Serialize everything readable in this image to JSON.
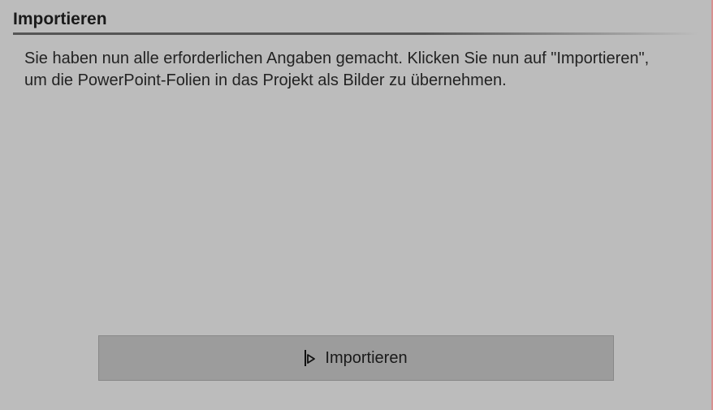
{
  "page": {
    "title": "Importieren",
    "description": "Sie haben nun alle erforderlichen Angaben gemacht. Klicken Sie nun auf \"Importieren\", um die PowerPoint-Folien in das Projekt als Bilder zu übernehmen."
  },
  "actions": {
    "import_button_label": "Importieren"
  }
}
